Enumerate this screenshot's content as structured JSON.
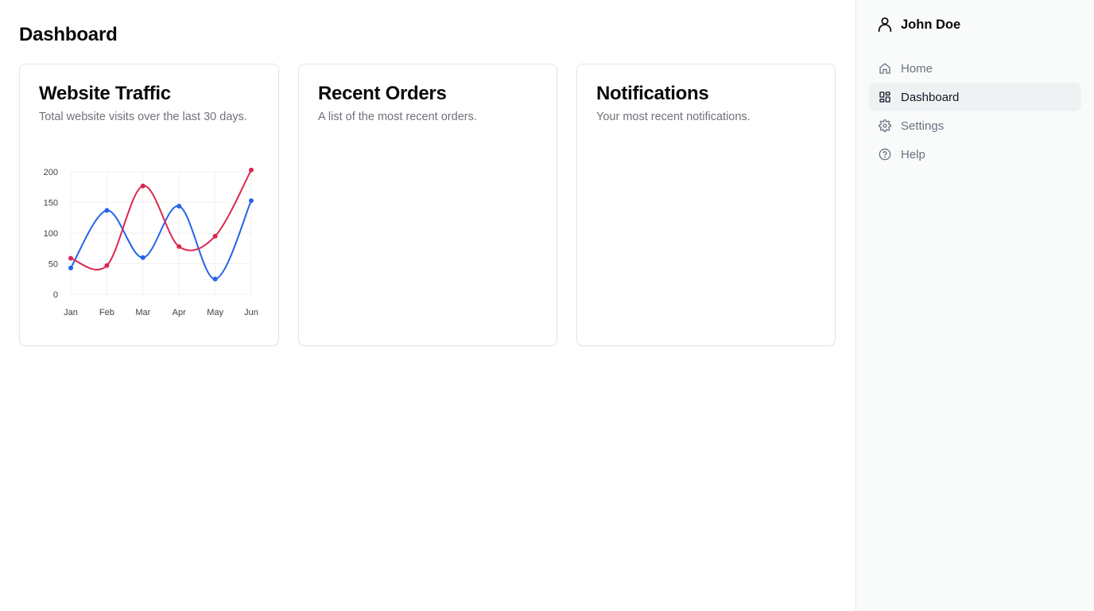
{
  "page": {
    "title": "Dashboard"
  },
  "cards": [
    {
      "title": "Website Traffic",
      "description": "Total website visits over the last 30 days."
    },
    {
      "title": "Recent Orders",
      "description": "A list of the most recent orders."
    },
    {
      "title": "Notifications",
      "description": "Your most recent notifications."
    }
  ],
  "sidebar": {
    "user": {
      "name": "John Doe",
      "icon": "user-icon"
    },
    "items": [
      {
        "label": "Home",
        "icon": "home-icon",
        "active": false
      },
      {
        "label": "Dashboard",
        "icon": "dashboard-icon",
        "active": true
      },
      {
        "label": "Settings",
        "icon": "gear-icon",
        "active": false
      },
      {
        "label": "Help",
        "icon": "help-circle-icon",
        "active": false
      }
    ]
  },
  "chart_data": {
    "type": "line",
    "x": [
      "Jan",
      "Feb",
      "Mar",
      "Apr",
      "May",
      "Jun"
    ],
    "yticks": [
      0,
      50,
      100,
      150,
      200
    ],
    "ylim": [
      0,
      200
    ],
    "grid": true,
    "series": [
      {
        "values": [
          43,
          137,
          60,
          144,
          25,
          153
        ],
        "color": "#2563eb"
      },
      {
        "values": [
          59,
          47,
          177,
          78,
          95,
          203
        ],
        "color": "#dc2650"
      }
    ]
  }
}
